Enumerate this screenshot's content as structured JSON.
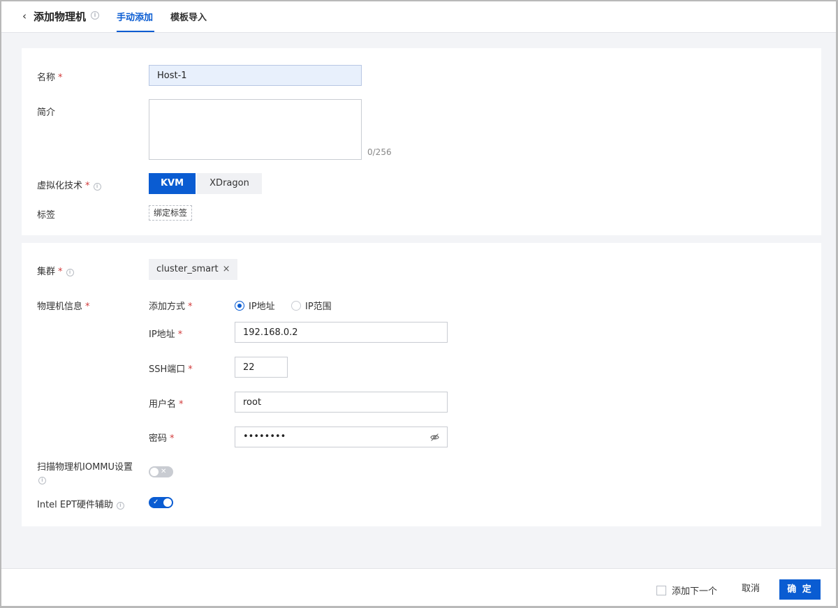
{
  "header": {
    "back_glyph": "‹",
    "title": "添加物理机",
    "tabs": [
      {
        "label": "手动添加",
        "active": true
      },
      {
        "label": "模板导入",
        "active": false
      }
    ]
  },
  "basic": {
    "name": {
      "label": "名称",
      "required": "*",
      "value": "Host-1"
    },
    "description": {
      "label": "简介",
      "value": "",
      "counter": "0/256"
    },
    "virtualization": {
      "label": "虚拟化技术",
      "required": "*",
      "options": [
        "KVM",
        "XDragon"
      ],
      "selected": "KVM"
    },
    "tags": {
      "label": "标签",
      "button": "绑定标签"
    }
  },
  "cluster": {
    "label": "集群",
    "required": "*",
    "chip": "cluster_smart",
    "remove_glyph": "×"
  },
  "host_info": {
    "label": "物理机信息",
    "required": "*",
    "add_mode": {
      "label": "添加方式",
      "required": "*",
      "options": [
        "IP地址",
        "IP范围"
      ],
      "selected": "IP地址"
    },
    "ip": {
      "label": "IP地址",
      "required": "*",
      "value": "192.168.0.2"
    },
    "ssh_port": {
      "label": "SSH端口",
      "required": "*",
      "value": "22"
    },
    "username": {
      "label": "用户名",
      "required": "*",
      "value": "root"
    },
    "password": {
      "label": "密码",
      "required": "*",
      "value": "••••••••",
      "icon": "eye-off-icon"
    }
  },
  "iommu": {
    "label": "扫描物理机IOMMU设置",
    "enabled": false,
    "glyph": "✕"
  },
  "ept": {
    "label": "Intel EPT硬件辅助",
    "enabled": true,
    "glyph": "✓"
  },
  "footer": {
    "add_next": "添加下一个",
    "cancel": "取消",
    "confirm": "确 定"
  },
  "colors": {
    "accent": "#0a5cd2",
    "required": "#d13b3b",
    "background": "#f3f4f7"
  }
}
